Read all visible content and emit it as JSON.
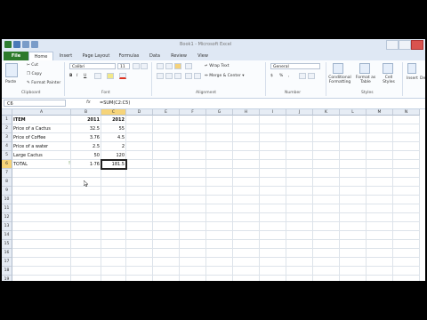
{
  "window": {
    "title": "Book1 - Microsoft Excel"
  },
  "tabs": [
    {
      "label": "File"
    },
    {
      "label": "Home"
    },
    {
      "label": "Insert"
    },
    {
      "label": "Page Layout"
    },
    {
      "label": "Formulas"
    },
    {
      "label": "Data"
    },
    {
      "label": "Review"
    },
    {
      "label": "View"
    }
  ],
  "ribbon": {
    "clipboard": {
      "paste": "Paste",
      "cut": "Cut",
      "copy": "Copy",
      "format_painter": "Format Painter",
      "label": "Clipboard"
    },
    "font": {
      "name": "Calibri",
      "size": "11",
      "bold": "B",
      "italic": "I",
      "underline": "U",
      "label": "Font"
    },
    "alignment": {
      "wrap": "Wrap Text",
      "merge": "Merge & Center",
      "label": "Alignment"
    },
    "number": {
      "format": "General",
      "currency": "$",
      "percent": "%",
      "comma": ",",
      "label": "Number"
    },
    "styles": {
      "conditional": "Conditional Formatting",
      "format_table": "Format as Table",
      "cell_styles": "Cell Styles",
      "label": "Styles"
    },
    "cells": {
      "insert": "Insert",
      "delete": "De"
    }
  },
  "formula_bar": {
    "name_box": "C6",
    "fx": "fx",
    "formula": "=SUM(C2:C5)"
  },
  "sheet": {
    "columns": [
      "A",
      "B",
      "C",
      "D",
      "E",
      "F",
      "G",
      "H",
      "I",
      "J",
      "K",
      "L",
      "M",
      "N"
    ],
    "row_numbers": [
      "1",
      "2",
      "3",
      "4",
      "5",
      "6",
      "7",
      "8",
      "9",
      "10",
      "11",
      "12",
      "13",
      "14",
      "15",
      "16",
      "17",
      "18",
      "19",
      "20"
    ],
    "rows": [
      {
        "a": "ITEM",
        "b": "2011",
        "c": "2012"
      },
      {
        "a": "Price of a Cactus",
        "b": "32.5",
        "c": "55"
      },
      {
        "a": "Price of Coffee",
        "b": "3.76",
        "c": "4.5"
      },
      {
        "a": "Price of a water",
        "b": "2.5",
        "c": "2"
      },
      {
        "a": "Large Cactus",
        "b": "50",
        "c": "120"
      },
      {
        "a": "TOTAL",
        "b": "1·76",
        "c": "181.5"
      }
    ],
    "active_cell": "C6",
    "error_flag_symbol": "!"
  },
  "colors": {
    "file_tab": "#2c7a2c",
    "selection_header": "#f6d47a",
    "ribbon_bg": "#fafcfe"
  }
}
